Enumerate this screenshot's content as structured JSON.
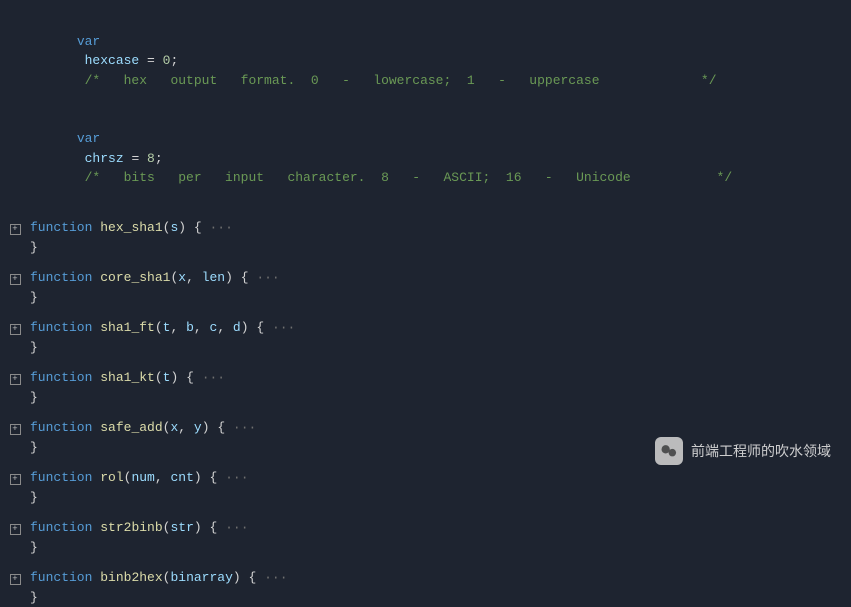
{
  "vars": [
    {
      "name": "hexcase",
      "value": "0",
      "comment": "/*   hex   output   format.  0   -   lowercase;  1   -   uppercase             */"
    },
    {
      "name": "chrsz",
      "value": "8",
      "comment": "/*   bits   per   input   character.  8   -   ASCII;  16   -   Unicode           */"
    }
  ],
  "functions": [
    {
      "name": "hex_sha1",
      "params": [
        "s"
      ]
    },
    {
      "name": "core_sha1",
      "params": [
        "x",
        "len"
      ]
    },
    {
      "name": "sha1_ft",
      "params": [
        "t",
        "b",
        "c",
        "d"
      ]
    },
    {
      "name": "sha1_kt",
      "params": [
        "t"
      ]
    },
    {
      "name": "safe_add",
      "params": [
        "x",
        "y"
      ]
    },
    {
      "name": "rol",
      "params": [
        "num",
        "cnt"
      ]
    },
    {
      "name": "str2binb",
      "params": [
        "str"
      ]
    },
    {
      "name": "binb2hex",
      "params": [
        "binarray"
      ]
    }
  ],
  "tokens": {
    "var": "var",
    "function": "function",
    "eq": " = ",
    "semi": ";",
    "open_brace": " {",
    "close_brace": "}",
    "open_paren": "(",
    "close_paren": ")",
    "comma": ", ",
    "ellipsis": " ···",
    "fold_symbol": "+"
  },
  "watermark": {
    "text": "前端工程师的吹水领域"
  }
}
